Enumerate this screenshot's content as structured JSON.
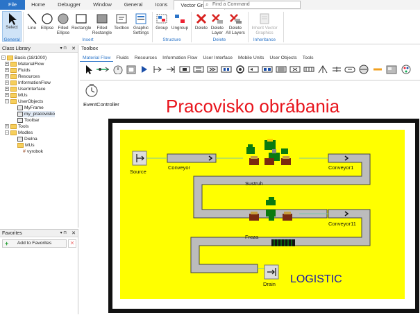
{
  "ribbon_tabs": [
    "File",
    "Home",
    "Debugger",
    "Window",
    "General",
    "Icons",
    "Vector Graphics"
  ],
  "search_placeholder": "Find a Command",
  "ribbon": {
    "select": "Select",
    "line": "Line",
    "ellipse": "Ellipse",
    "filled_ellipse_1": "Filled",
    "filled_ellipse_2": "Ellipse",
    "rectangle": "Rectangle",
    "filled_rect_1": "Filled",
    "filled_rect_2": "Rectangle",
    "textbox": "Textbox",
    "graphic_settings_1": "Graphic",
    "graphic_settings_2": "Settings",
    "group": "Group",
    "ungroup": "Ungroup",
    "delete": "Delete",
    "delete_layer_1": "Delete",
    "delete_layer_2": "Layer",
    "delete_all_1": "Delete",
    "delete_all_2": "All Layers",
    "inherit_1": "Inherit Vector",
    "inherit_2": "Graphics",
    "groups": {
      "general": "General",
      "insert": "Insert",
      "structure": "Structure",
      "delete": "Delete",
      "inheritance": "Inheritance"
    }
  },
  "class_library": {
    "title": "Class Library",
    "root": "Basis (18/1000)",
    "items": [
      "MaterialFlow",
      "Fluids",
      "Resources",
      "InformationFlow",
      "UserInterface",
      "MUs",
      "UserObjects",
      "MyFrame",
      "my_pracovisko",
      "Toolbar",
      "Tools",
      "Modles",
      "Dielna",
      "MUs",
      "vyrobok"
    ]
  },
  "favorites": {
    "title": "Favorites",
    "add": "Add to Favorites"
  },
  "toolbox": {
    "title": "Toolbox",
    "tabs": [
      "Material Flow",
      "Fluids",
      "Resources",
      "Information Flow",
      "User Interface",
      "Mobile Units",
      "User Objects",
      "Tools"
    ]
  },
  "model": {
    "title": "Pracovisko obrábania",
    "event_controller": "EventController",
    "source": "Source",
    "conveyor": "Conveyor",
    "conveyor1": "Conveyor1",
    "sustruh": "Sustruh",
    "conveyor11": "Conveyor11",
    "freza": "Freza",
    "drain": "Drain",
    "logistic": "LOGISTIC"
  },
  "colors": {
    "accent": "#2b74c8",
    "yellow": "#ffff00",
    "red_title": "#e8141c",
    "logistic_blue": "#1a1aaa"
  }
}
